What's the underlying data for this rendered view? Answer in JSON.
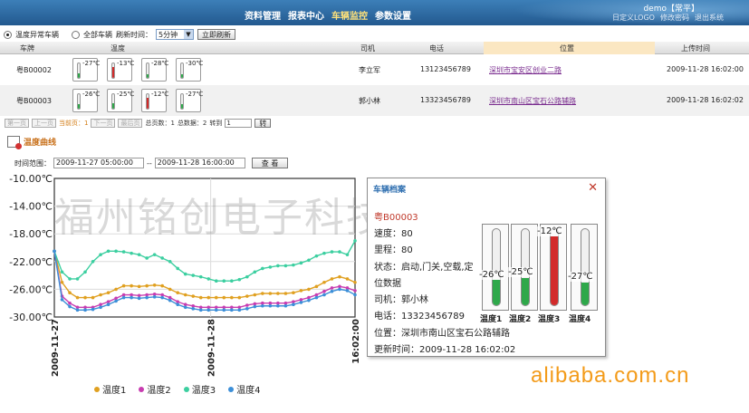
{
  "header": {
    "nav": [
      "资料管理",
      "报表中心",
      "车辆监控",
      "参数设置"
    ],
    "active_index": 2,
    "user": "demo【常平】",
    "user_links": [
      "日定义LOGO",
      "修改密码",
      "退出系统"
    ]
  },
  "toolbar": {
    "radio_abnormal": "温度异常车辆",
    "radio_all": "全部车辆",
    "refresh_label": "刷新时间：",
    "refresh_value": "5分钟",
    "refresh_now": "立即刷新"
  },
  "table": {
    "headers": [
      "车牌",
      "温度",
      "司机",
      "电话",
      "位置",
      "上传时间"
    ],
    "rows": [
      {
        "plate": "粤B00002",
        "temps": [
          {
            "t": "-27℃",
            "level": 0.3,
            "color": "#2ea84a"
          },
          {
            "t": "-13℃",
            "level": 0.75,
            "color": "#d22b2b"
          },
          {
            "t": "-28℃",
            "level": 0.28,
            "color": "#2ea84a"
          },
          {
            "t": "-30℃",
            "level": 0.22,
            "color": "#2ea84a"
          }
        ],
        "driver": "李立军",
        "phone": "13123456789",
        "location": "深圳市宝安区创业二路",
        "time": "2009-11-28 16:02:00"
      },
      {
        "plate": "粤B00003",
        "temps": [
          {
            "t": "-26℃",
            "level": 0.32,
            "color": "#2ea84a"
          },
          {
            "t": "-25℃",
            "level": 0.35,
            "color": "#2ea84a"
          },
          {
            "t": "-12℃",
            "level": 0.78,
            "color": "#d22b2b"
          },
          {
            "t": "-27℃",
            "level": 0.3,
            "color": "#2ea84a"
          }
        ],
        "driver": "郭小林",
        "phone": "13323456789",
        "location": "深圳市南山区宝石公路辅路",
        "time": "2009-11-28 16:02:02"
      }
    ]
  },
  "pager": {
    "first": "第一页",
    "prev": "上一页",
    "current": "当前页：1",
    "next": "下一页",
    "last": "最后页",
    "total_pages": "总页数：1",
    "total_records": "总数据：2",
    "goto": "转到",
    "page_value": "1",
    "go": "转"
  },
  "curve": {
    "title": "温度曲线",
    "range_label": "时间范围：",
    "start": "2009-11-27 05:00:00",
    "sep": "--",
    "end": "2009-11-28 16:00:00",
    "query": "查 看"
  },
  "popup": {
    "title": "车辆档案",
    "plate": "粤B00003",
    "speed": "速度：80",
    "mileage": "里程：80",
    "status": "状态：启动,门关,空载,定",
    "status2": "位数据",
    "driver": "司机：郭小林",
    "phone": "电话：13323456789",
    "location": "位置：深圳市南山区宝石公路辅路",
    "updated": "更新时间：2009-11-28 16:02:02",
    "therms": [
      {
        "label": "温度1",
        "value": "-26℃",
        "level": 0.33,
        "color": "#2ea84a"
      },
      {
        "label": "温度2",
        "value": "-25℃",
        "level": 0.36,
        "color": "#2ea84a"
      },
      {
        "label": "温度3",
        "value": "-12℃",
        "level": 0.9,
        "color": "#d22b2b"
      },
      {
        "label": "温度4",
        "value": "-27℃",
        "level": 0.3,
        "color": "#2ea84a"
      }
    ]
  },
  "watermark": "福州铭创电子科技有限公司",
  "alibaba": "alibaba.com.cn",
  "chart_data": {
    "type": "line",
    "ylim": [
      -30,
      -10
    ],
    "yticks": [
      "-10.00℃",
      "-14.00℃",
      "-18.00℃",
      "-22.00℃",
      "-26.00℃",
      "-30.00℃"
    ],
    "xticks": [
      "2009-11-27",
      "2009-11-28",
      "16:02:00"
    ],
    "grid": true,
    "legend_placement": "bottom",
    "series": [
      {
        "name": "温度1",
        "color": "#e0a020",
        "values": [
          -20.5,
          -25,
          -26.5,
          -27.2,
          -27.2,
          -27.2,
          -26.8,
          -26.5,
          -26,
          -25.5,
          -25.5,
          -25.6,
          -25.5,
          -25.4,
          -25.5,
          -26,
          -26.5,
          -26.8,
          -27,
          -27.2,
          -27.2,
          -27.2,
          -27.2,
          -27.2,
          -27.2,
          -27,
          -26.8,
          -26.6,
          -26.6,
          -26.6,
          -26.6,
          -26.5,
          -26.2,
          -26,
          -25.6,
          -25,
          -24.5,
          -24.2,
          -24.5,
          -25
        ]
      },
      {
        "name": "温度2",
        "color": "#c83cb0",
        "values": [
          -20.5,
          -27,
          -28,
          -28.6,
          -28.6,
          -28.6,
          -28.2,
          -27.8,
          -27.3,
          -26.8,
          -26.8,
          -26.9,
          -26.8,
          -26.7,
          -26.8,
          -27.2,
          -27.8,
          -28.2,
          -28.4,
          -28.6,
          -28.6,
          -28.6,
          -28.6,
          -28.6,
          -28.6,
          -28.3,
          -28.1,
          -28,
          -28,
          -28,
          -28,
          -27.8,
          -27.5,
          -27.2,
          -26.8,
          -26.3,
          -25.8,
          -25.6,
          -25.8,
          -26.2
        ]
      },
      {
        "name": "温度3",
        "color": "#3ccfa0",
        "values": [
          -20.5,
          -23.5,
          -24.5,
          -24.5,
          -23.5,
          -22,
          -21,
          -20.5,
          -20.5,
          -20.6,
          -20.8,
          -21,
          -21.5,
          -21,
          -21.5,
          -22,
          -23,
          -23.8,
          -24,
          -24.2,
          -24.5,
          -24.8,
          -24.8,
          -24.8,
          -24.6,
          -24.2,
          -23.5,
          -23,
          -22.8,
          -22.6,
          -22.6,
          -22.5,
          -22.2,
          -21.8,
          -21.2,
          -20.8,
          -20.6,
          -20.6,
          -21,
          -19
        ]
      },
      {
        "name": "温度4",
        "color": "#3c8fd8",
        "values": [
          -20.5,
          -27.5,
          -28.5,
          -29,
          -29,
          -28.9,
          -28.6,
          -28.2,
          -27.7,
          -27.2,
          -27.2,
          -27.3,
          -27.2,
          -27.1,
          -27.2,
          -27.6,
          -28.2,
          -28.6,
          -28.8,
          -29,
          -29,
          -29,
          -29,
          -29,
          -29,
          -28.8,
          -28.5,
          -28.4,
          -28.4,
          -28.4,
          -28.4,
          -28.2,
          -27.9,
          -27.6,
          -27.2,
          -26.8,
          -26.3,
          -26,
          -26.2,
          -26.8
        ]
      }
    ]
  }
}
